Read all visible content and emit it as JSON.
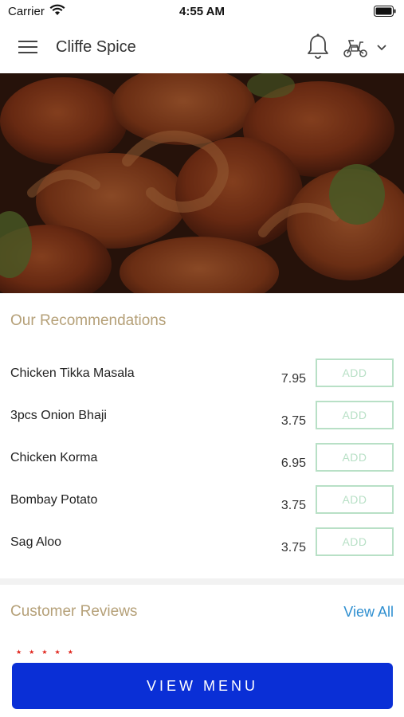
{
  "status_bar": {
    "carrier": "Carrier",
    "time": "4:55 AM",
    "icons": [
      "wifi-icon",
      "battery-icon"
    ]
  },
  "header": {
    "title": "Cliffe Spice",
    "icons": [
      "menu-icon",
      "bell-icon",
      "scooter-icon",
      "chevron-down-icon"
    ]
  },
  "hero": {
    "image": "prawn-dish-photo"
  },
  "recommendations": {
    "title": "Our Recommendations",
    "items": [
      {
        "name": "Chicken Tikka Masala",
        "price": "7.95",
        "button": "ADD"
      },
      {
        "name": "3pcs Onion Bhaji",
        "price": "3.75",
        "button": "ADD"
      },
      {
        "name": "Chicken Korma",
        "price": "6.95",
        "button": "ADD"
      },
      {
        "name": "Bombay Potato",
        "price": "3.75",
        "button": "ADD"
      },
      {
        "name": "Sag Aloo",
        "price": "3.75",
        "button": "ADD"
      }
    ]
  },
  "reviews": {
    "title": "Customer Reviews",
    "view_all": "View All",
    "rating_stars": 5
  },
  "footer": {
    "view_menu": "VIEW MENU"
  },
  "colors": {
    "accent_gold": "#b5a078",
    "add_green": "#b8e0c6",
    "link_blue": "#2f8fd0",
    "primary_button": "#0a2fd6",
    "star_red": "#e0241b"
  }
}
